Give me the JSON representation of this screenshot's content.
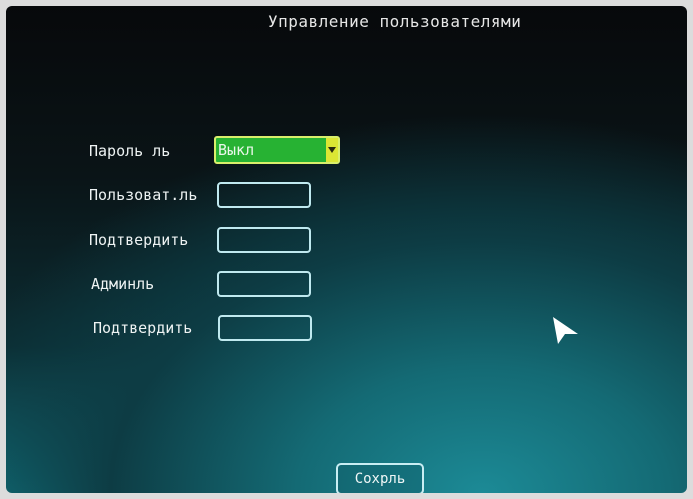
{
  "title": "Управление пользователями",
  "form": {
    "password_label": "Пароль ль",
    "password_value": "Выкл",
    "user_label": "Пользоват.ль",
    "confirm_label_1": "Подтвердить",
    "admin_label": "Админль",
    "confirm_label_2": "Подтвердить"
  },
  "save_button": "Сохрль",
  "icons": {
    "dropdown": "chevron-down-icon",
    "cursor": "mouse-pointer-icon"
  },
  "colors": {
    "select_bg": "#27b233",
    "select_border": "#d9ef6b",
    "field_border": "#bfe9ef"
  }
}
